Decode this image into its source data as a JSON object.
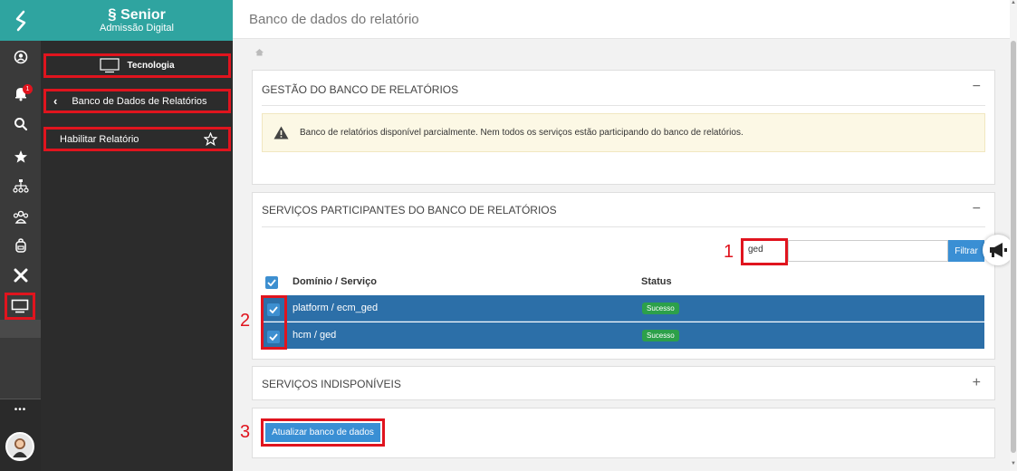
{
  "brand": {
    "name": "Senior",
    "subtitle": "Admissão Digital"
  },
  "rail": {
    "notification_count": "1",
    "more": "•••"
  },
  "menu": {
    "section": "Tecnologia",
    "back_item": "Banco de Dados de Relatórios",
    "item": "Habilitar Relatório"
  },
  "page": {
    "title": "Banco de dados do relatório"
  },
  "gestao": {
    "title": "GESTÃO DO BANCO DE RELATÓRIOS",
    "collapse": "−",
    "alert": "Banco de relatórios disponível parcialmente. Nem todos os serviços estão participando do banco de relatórios."
  },
  "participantes": {
    "title": "SERVIÇOS PARTICIPANTES DO BANCO DE RELATÓRIOS",
    "collapse": "−",
    "filter_value": "ged",
    "filter_button": "Filtrar",
    "columns": [
      "Domínio / Serviço",
      "Status"
    ],
    "rows": [
      {
        "service": "platform / ecm_ged",
        "status": "Sucesso"
      },
      {
        "service": "hcm / ged",
        "status": "Sucesso"
      }
    ]
  },
  "indisponiveis": {
    "title": "SERVIÇOS INDISPONÍVEIS",
    "expand": "+"
  },
  "update_button": "Atualizar banco de dados",
  "callouts": [
    "1",
    "2",
    "3"
  ],
  "colors": {
    "teal": "#2fa4a0",
    "row_blue": "#2c6fa8",
    "button_blue": "#3a8fd4",
    "success": "#2ca04a",
    "highlight_red": "#e0141e"
  }
}
